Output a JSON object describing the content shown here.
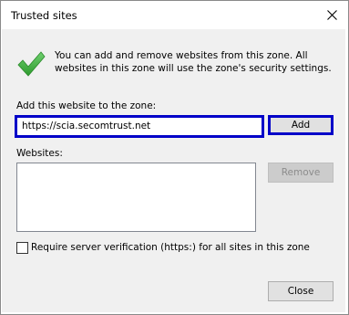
{
  "window": {
    "title": "Trusted sites",
    "close_icon": "close-icon"
  },
  "info": {
    "icon": "checkmark-icon",
    "text": "You can add and remove websites from this zone. All websites in this zone will use the zone's security settings."
  },
  "add_section": {
    "label": "Add this website to the zone:",
    "input_value": "https://scia.secomtrust.net",
    "add_button": "Add"
  },
  "websites": {
    "label": "Websites:",
    "items": [],
    "remove_button": "Remove"
  },
  "require_https": {
    "label": "Require server verification (https:) for all sites in this zone",
    "checked": false
  },
  "footer": {
    "close_button": "Close"
  },
  "colors": {
    "focus_highlight": "#0000c8",
    "checkmark": "#3aa83a",
    "dialog_background": "#f0f0f0"
  }
}
